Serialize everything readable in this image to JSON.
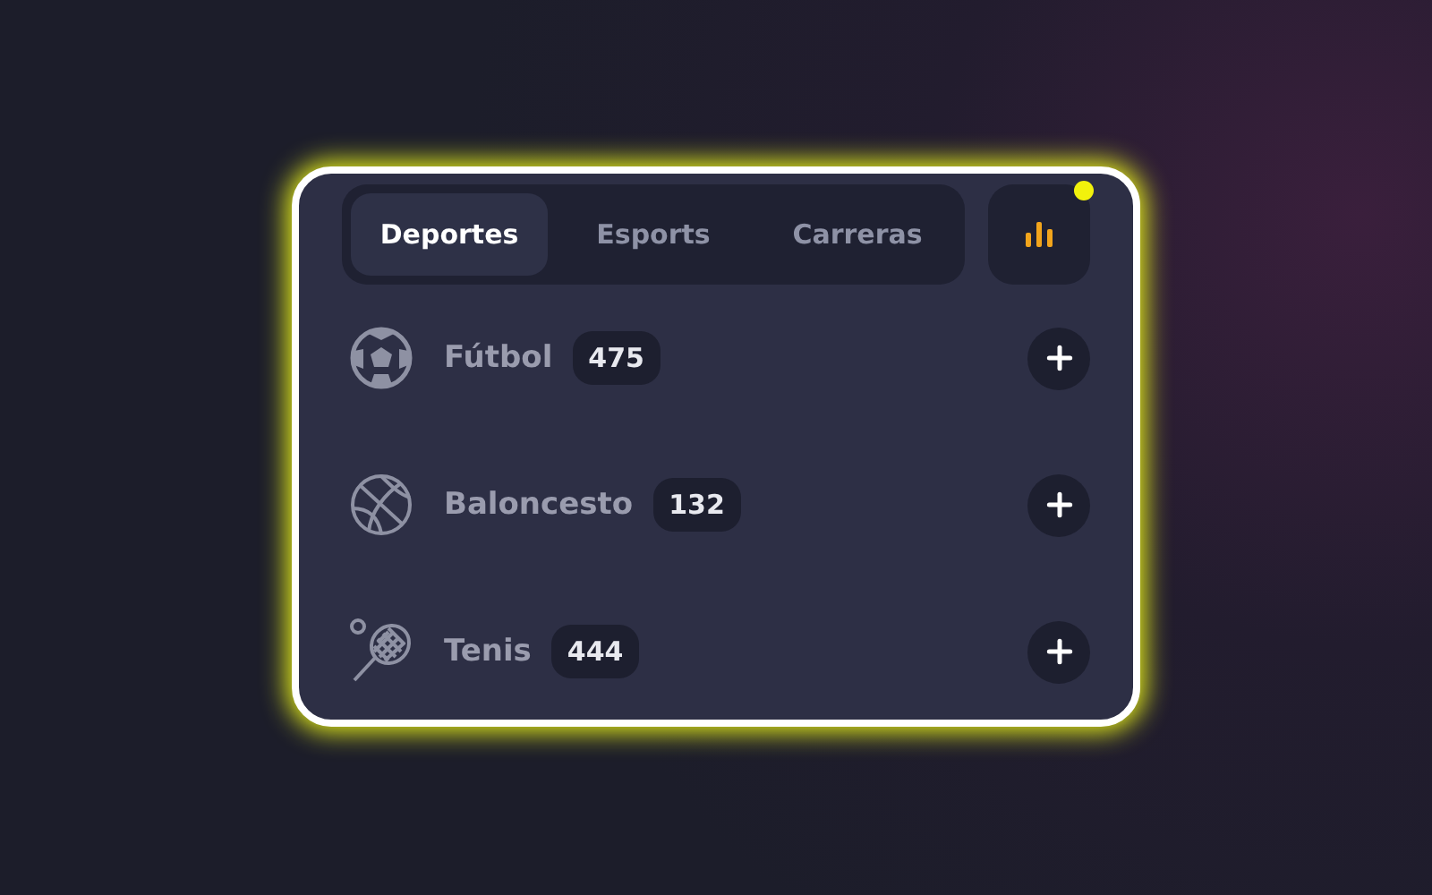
{
  "tabs": [
    {
      "label": "Deportes",
      "selected": true
    },
    {
      "label": "Esports",
      "selected": false
    },
    {
      "label": "Carreras",
      "selected": false
    }
  ],
  "stats_button": {
    "notification": true
  },
  "sports": [
    {
      "kind": "soccer",
      "name": "Fútbol",
      "count": "475"
    },
    {
      "kind": "basketball",
      "name": "Baloncesto",
      "count": "132"
    },
    {
      "kind": "tennis",
      "name": "Tenis",
      "count": "444"
    }
  ]
}
